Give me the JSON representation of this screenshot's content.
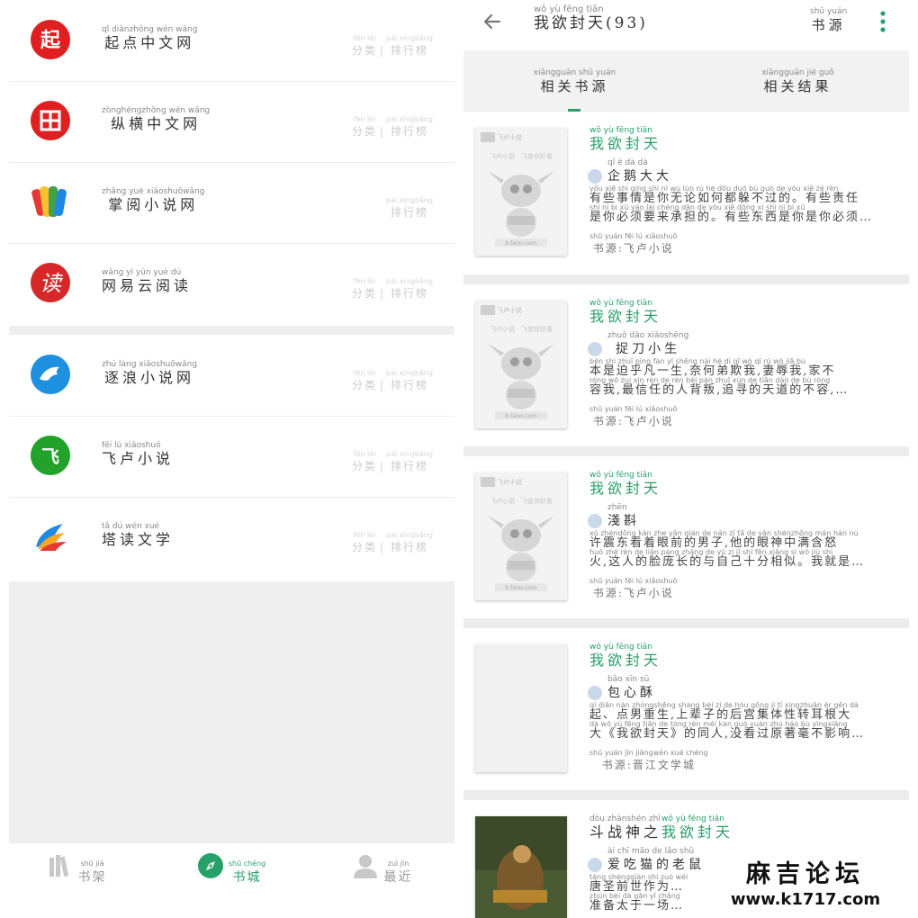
{
  "left": {
    "sites": [
      {
        "name": "起点中文网",
        "pinyin": "qǐ diǎnzhōng wén wǎng",
        "cat": "分类",
        "cat_py": "fēn lèi",
        "rank": "排行榜",
        "rank_py": "pái xíngbǎng",
        "logo_color": "#e02020"
      },
      {
        "name": "纵横中文网",
        "pinyin": "zònghéngzhōng wén wǎng",
        "cat": "分类",
        "cat_py": "fēn lèi",
        "rank": "排行榜",
        "rank_py": "pái xíngbǎng",
        "logo_color": "#e02020"
      },
      {
        "name": "掌阅小说网",
        "pinyin": "zhǎng yuè xiǎoshuōwǎng",
        "cat": "",
        "cat_py": "",
        "rank": "排行榜",
        "rank_py": "pái xíngbǎng",
        "logo_color": "#f5a623"
      },
      {
        "name": "网易云阅读",
        "pinyin": "wǎng yì yún yuè dú",
        "cat": "分类",
        "cat_py": "fēn lèi",
        "rank": "排行榜",
        "rank_py": "pái xíngbǎng",
        "logo_color": "#d62828"
      },
      {
        "name": "逐浪小说网",
        "pinyin": "zhú làng xiǎoshuōwǎng",
        "cat": "分类",
        "cat_py": "fēn lèi",
        "rank": "排行榜",
        "rank_py": "pái xíngbǎng",
        "logo_color": "#1e90e0"
      },
      {
        "name": "飞卢小说",
        "pinyin": "fēi lú xiǎoshuō",
        "cat": "分类",
        "cat_py": "fēn lèi",
        "rank": "排行榜",
        "rank_py": "pái xíngbǎng",
        "logo_color": "#22a22a"
      },
      {
        "name": "塔读文学",
        "pinyin": "tǎ dú wén xué",
        "cat": "分类",
        "cat_py": "fēn lèi",
        "rank": "排行榜",
        "rank_py": "pái xíngbǎng",
        "logo_color": "#f08a24"
      }
    ],
    "separator": "|",
    "nav": [
      {
        "label": "书架",
        "pinyin": "shū jià",
        "active": false
      },
      {
        "label": "书城",
        "pinyin": "shū chéng",
        "active": true
      },
      {
        "label": "最近",
        "pinyin": "zuì jìn",
        "active": false
      }
    ]
  },
  "right": {
    "title": "我欲封天(93)",
    "title_py": "wǒ yù fēng tiān",
    "source_label": "书源",
    "source_py": "shū yuán",
    "tabs": [
      {
        "label": "相关书源",
        "pinyin": "xiāngguān shū yuán",
        "active": true
      },
      {
        "label": "相关结果",
        "pinyin": "xiāngguān jié guǒ",
        "active": false
      }
    ],
    "books": [
      {
        "prefix": "",
        "prefix_py": "",
        "name": "我欲封天",
        "name_py": "wǒ yù fēng tiān",
        "author": "企鹅大大",
        "author_py": "qǐ é dà dà",
        "desc1": "有些事情是你无论如何都躲不过的。有些责任",
        "desc1_py": "yǒu xiē shì qing shì nǐ wú lùn rú hé dōu duǒ bù guò de  yǒu xiē zé rèn",
        "desc2": "是你必须要来承担的。有些东西是你是你必须…",
        "desc2_py": "shì nǐ bì xū yào lái chéng dān de  yǒu xiē dōng xi shì nǐ bì xū",
        "source": "书源:飞卢小说",
        "source_py": "shū yuán  fēi lú xiǎoshuō",
        "cover": "feilu"
      },
      {
        "prefix": "",
        "prefix_py": "",
        "name": "我欲封天",
        "name_py": "wǒ yù fēng tiān",
        "author": "捉刀小生",
        "author_py": "zhuō dāo xiǎoshēng",
        "desc1": "本是迫乎凡一生,奈何弟欺我,妻辱我,家不",
        "desc1_py": "běn shì zhuī píng fán yī shēng  nài hé dì qī wǒ  qī rǔ wǒ  jiā bù",
        "desc2": "容我,最信任的人背叛,追寻的天道的不容,…",
        "desc2_py": "róng wǒ  zuì xìn rèn de rén bèi pàn  zhuī xún de tiān dào de bù róng",
        "source": "书源:飞卢小说",
        "source_py": "shū yuán  fēi lú xiǎoshuō",
        "cover": "feilu"
      },
      {
        "prefix": "",
        "prefix_py": "",
        "name": "我欲封天",
        "name_py": "wǒ yù fēng tiān",
        "author": "淺斟",
        "author_py": "zhēn",
        "desc1": "许震东看着眼前的男子,他的眼神中满含怒",
        "desc1_py": "xǔ zhèndōng kàn zhe yǎn qián de nán zǐ  tā de yǎn shénzhōng mǎn hán nù",
        "desc2": "火,这人的脸庞长的与自己十分相似。我就是…",
        "desc2_py": "huǒ  zhè rén de liǎn páng zhǎng de yǔ zì jǐ shí fēn xiāng sì  wǒ jiù shì",
        "source": "书源:飞卢小说",
        "source_py": "shū yuán  fēi lú xiǎoshuō",
        "cover": "feilu"
      },
      {
        "prefix": "",
        "prefix_py": "",
        "name": "我欲封天",
        "name_py": "wǒ yù fēng tiān",
        "author": "包心酥",
        "author_py": "bāo xīn sū",
        "desc1": "起、点男重生,上辈子的后宫集体性转耳根大",
        "desc1_py": "qǐ diǎn nán zhòngshēng  shàng bèi zi de hòu gōng jí tǐ xìngzhuǎn ěr gēn dà",
        "desc2": "大《我欲封天》的同人,没看过原著毫不影响…",
        "desc2_py": "dà  wǒ yù fēng tiān  de tóng rén  méi kàn guò yuán zhù háo bù yǐngxiǎng",
        "source": "书源:晋江文学城",
        "source_py": "shū yuán  jìn jiāngwén xué chéng",
        "cover": "blank"
      },
      {
        "prefix": "斗战神之",
        "prefix_py": "dòu zhànshén zhī",
        "name": "我欲封天",
        "name_py": "wǒ yù fēng tiān",
        "author": "爱吃猫的老鼠",
        "author_py": "ài chī māo de lǎo shǔ",
        "desc1": "唐圣前世作为…",
        "desc1_py": "táng shèngqián shì zuò wéi",
        "desc2": "准备太于一场…",
        "desc2_py": "zhǔn bèi dà gān yī chǎng",
        "source": "",
        "source_py": "",
        "cover": "art"
      }
    ],
    "cover_text": {
      "brand": "飞卢小说",
      "slogan": "飞卢小说 · 飞变你好看",
      "url": "b.faloo.com"
    }
  },
  "watermark": {
    "title": "麻吉论坛",
    "url": "www.k1717.com"
  },
  "colors": {
    "accent": "#27a06a",
    "divider": "#ececec"
  }
}
